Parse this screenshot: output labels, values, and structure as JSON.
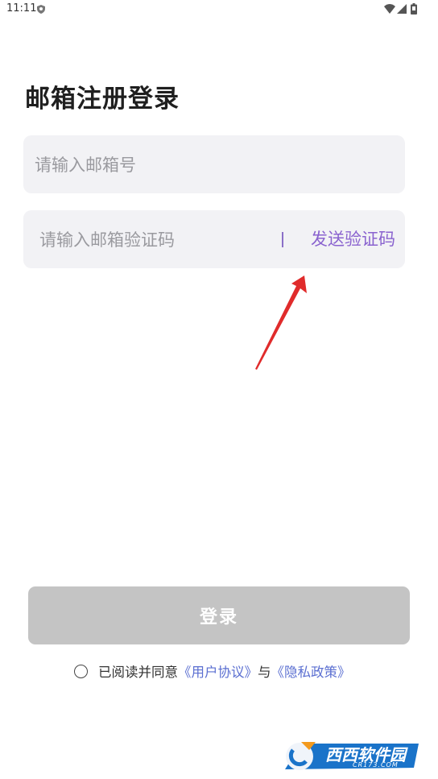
{
  "status_bar": {
    "time": "11:11",
    "icons": [
      "shield-icon",
      "wifi-icon",
      "signal-icon",
      "battery-icon"
    ]
  },
  "page": {
    "title": "邮箱注册登录"
  },
  "form": {
    "email_placeholder": "请输入邮箱号",
    "email_value": "",
    "code_placeholder": "请输入邮箱验证码",
    "code_value": "",
    "send_code_label": "发送验证码",
    "login_label": "登录"
  },
  "agreement": {
    "prefix": "已阅读并同意",
    "user_agreement": "《用户协议》",
    "joiner": "与",
    "privacy_policy": "《隐私政策》",
    "checked": false
  },
  "watermark": {
    "logo_text": "西西软件园",
    "sub_text": "CR173.COM"
  },
  "colors": {
    "accent": "#8a63cf",
    "link": "#5b6fd1",
    "field_bg": "#f2f2f5",
    "button_disabled": "#c4c4c4",
    "annotation_arrow": "#e02b2b"
  }
}
